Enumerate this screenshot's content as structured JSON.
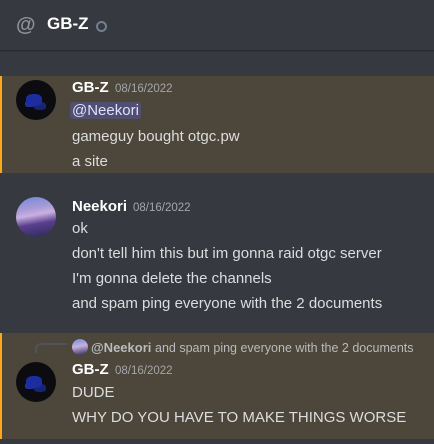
{
  "header": {
    "channel": "GB-Z",
    "icon": "at-icon",
    "status": "offline"
  },
  "messages": [
    {
      "author": "GB-Z",
      "timestamp": "08/16/2022",
      "mention": "@Neekori",
      "lines": [
        "gameguy bought otgc.pw",
        "a site"
      ]
    },
    {
      "author": "Neekori",
      "timestamp": "08/16/2022",
      "lines": [
        "ok",
        "don't tell him this but im gonna raid otgc server",
        "I'm gonna delete the channels",
        "and spam ping everyone with the 2 documents"
      ]
    },
    {
      "reply": {
        "author": "@Neekori",
        "text": "and spam ping everyone with the 2 documents"
      },
      "author": "GB-Z",
      "timestamp": "08/16/2022",
      "lines": [
        "DUDE",
        "WHY DO YOU HAVE TO MAKE THINGS WORSE"
      ]
    }
  ],
  "colors": {
    "background": "#36393f",
    "mention_highlight": "#faa81a",
    "mention_pill": "#5865f2"
  }
}
